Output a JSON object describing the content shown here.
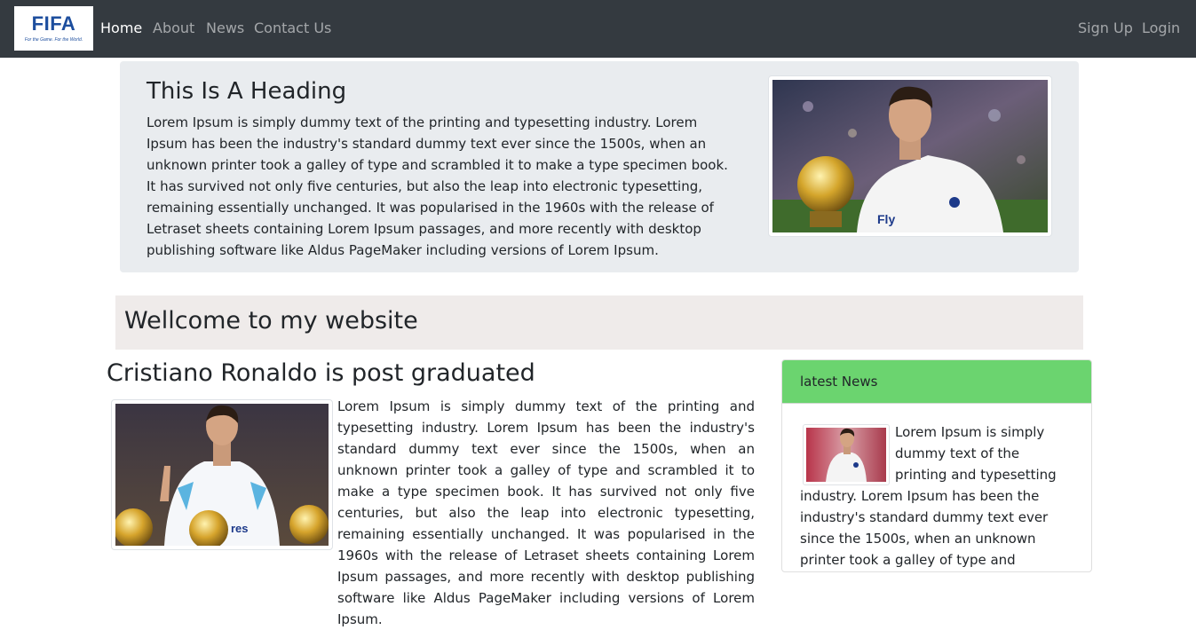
{
  "navbar": {
    "logo_text": "FIFA",
    "logo_tagline": "For the Game. For the World.",
    "links": [
      {
        "label": "Home",
        "active": true
      },
      {
        "label": "About",
        "active": false
      },
      {
        "label": "News",
        "active": false
      },
      {
        "label": "Contact Us",
        "active": false
      }
    ],
    "right_links": [
      {
        "label": "Sign Up"
      },
      {
        "label": "Login"
      }
    ]
  },
  "jumbotron": {
    "heading": "This Is A Heading",
    "text": "Lorem Ipsum is simply dummy text of the printing and typesetting industry. Lorem Ipsum has been the industry's standard dummy text ever since the 1500s, when an unknown printer took a galley of type and scrambled it to make a type specimen book. It has survived not only five centuries, but also the leap into electronic typesetting, remaining essentially unchanged. It was popularised in the 1960s with the release of Letraset sheets containing Lorem Ipsum passages, and more recently with desktop publishing software like Aldus PageMaker including versions of Lorem Ipsum."
  },
  "welcome": {
    "title": "Wellcome to my website"
  },
  "article": {
    "title": "Cristiano Ronaldo is post graduated",
    "text": "Lorem Ipsum is simply dummy text of the printing and typesetting industry. Lorem Ipsum has been the industry's standard dummy text ever since the 1500s, when an unknown printer took a galley of type and scrambled it to make a type specimen book. It has survived not only five centuries, but also the leap into electronic typesetting, remaining essentially unchanged. It was popularised in the 1960s with the release of Letraset sheets containing Lorem Ipsum passages, and more recently with desktop publishing software like Aldus PageMaker including versions of Lorem Ipsum."
  },
  "news": {
    "header": "latest News",
    "text": "Lorem Ipsum is simply dummy text of the printing and typesetting industry. Lorem Ipsum has been the industry's standard dummy text ever since the 1500s, when an unknown printer took a galley of type and scrambled it to make a type specimen book."
  },
  "colors": {
    "navbar_bg": "#343a40",
    "jumbotron_bg": "#e9ecef",
    "welcome_bg": "#efebea",
    "news_header_bg": "#6bd46f",
    "logo_blue": "#1d4e9e"
  }
}
